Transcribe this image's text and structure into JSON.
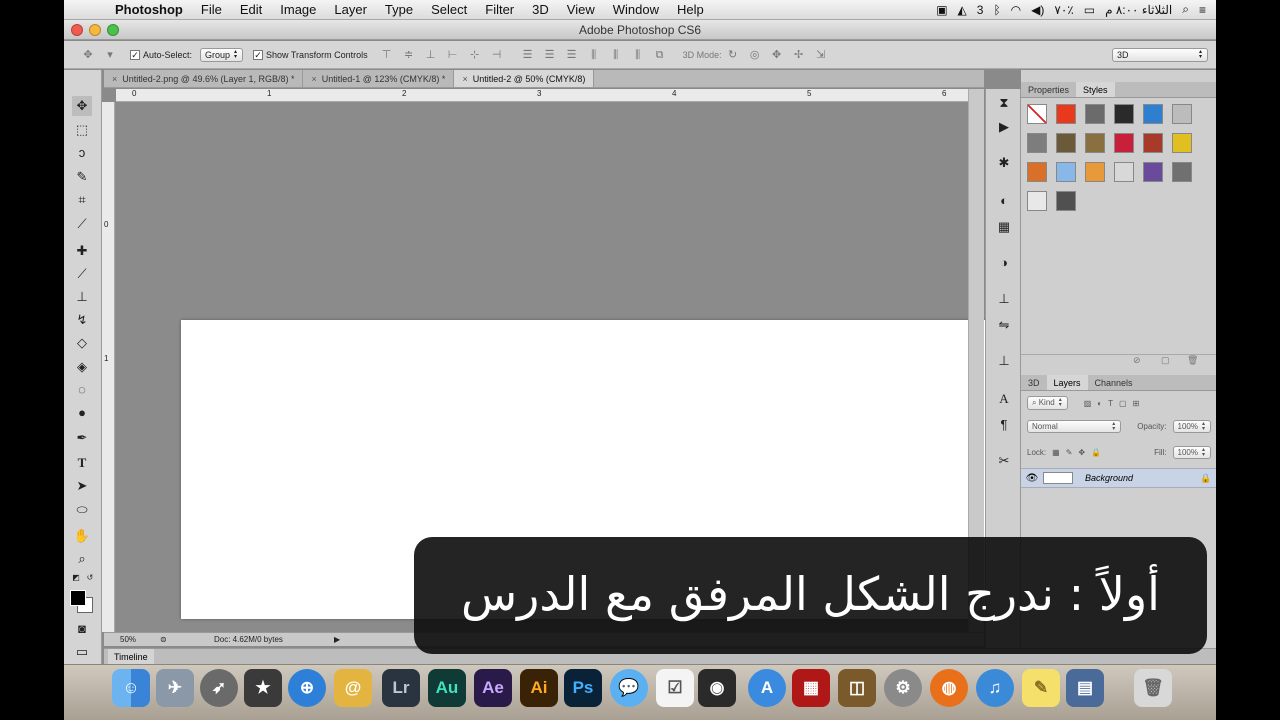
{
  "menubar": {
    "app": "Photoshop",
    "menus": [
      "File",
      "Edit",
      "Image",
      "Layer",
      "Type",
      "Select",
      "Filter",
      "3D",
      "View",
      "Window",
      "Help"
    ],
    "status_number": "3",
    "status_percent": "٧٠٪",
    "status_date": "الثلاثاء ٨:٠٠ م"
  },
  "window": {
    "title": "Adobe Photoshop CS6"
  },
  "options": {
    "auto_select_label": "Auto-Select:",
    "auto_select_value": "Group",
    "show_transform_label": "Show Transform Controls",
    "mode_label": "3D Mode:",
    "workspace_value": "3D"
  },
  "tabs": [
    {
      "label": "Untitled-2.png @ 49.6% (Layer 1, RGB/8) *",
      "active": false
    },
    {
      "label": "Untitled-1 @ 123% (CMYK/8) *",
      "active": false
    },
    {
      "label": "Untitled-2 @ 50% (CMYK/8)",
      "active": true
    }
  ],
  "ruler": {
    "h_ticks": [
      "0",
      "1",
      "2",
      "3",
      "4",
      "5",
      "6"
    ],
    "v_ticks": [
      "0",
      "1"
    ]
  },
  "statusbar": {
    "zoom": "50%",
    "doc": "Doc: 4.62M/0 bytes"
  },
  "timeline": {
    "label": "Timeline"
  },
  "panels": {
    "top_tabs": [
      "Properties",
      "Styles"
    ],
    "bottom_tabs": [
      "3D",
      "Layers",
      "Channels"
    ],
    "kind_label": "Kind",
    "blend_mode": "Normal",
    "opacity_label": "Opacity:",
    "opacity_value": "100%",
    "lock_label": "Lock:",
    "fill_label": "Fill:",
    "fill_value": "100%",
    "layer_name": "Background"
  },
  "styles_colors": [
    "#ffffff",
    "#e8391d",
    "#6b6b6b",
    "#2a2a2a",
    "#2f7fd1",
    "#bcbcbc",
    "#7d7d7d",
    "#6a5a3a",
    "#8a7040",
    "#c8203a",
    "#a83a2a",
    "#e0c020",
    "#d8702a",
    "#88b8e8",
    "#e89a3a",
    "#d8d8d8",
    "#6a4a9a",
    "#707070",
    "#e8e8e8",
    "#505050"
  ],
  "dock": [
    "Lr",
    "Au",
    "Ae",
    "Ai",
    "Ps"
  ],
  "subtitle": "أولاً : ندرج الشكل المرفق مع الدرس"
}
